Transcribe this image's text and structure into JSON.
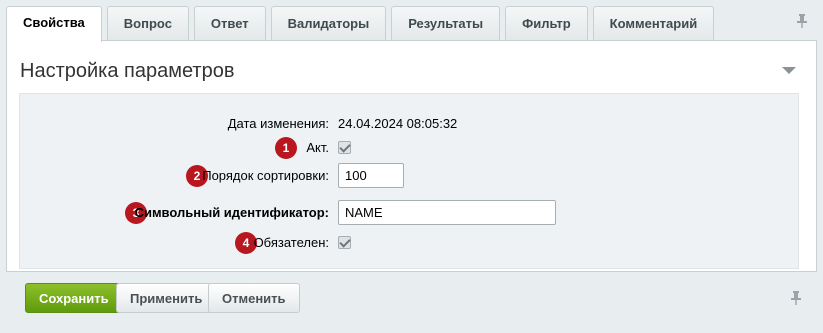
{
  "tabs": [
    "Свойства",
    "Вопрос",
    "Ответ",
    "Валидаторы",
    "Результаты",
    "Фильтр",
    "Комментарий"
  ],
  "section": {
    "title": "Настройка параметров"
  },
  "form": {
    "date_label": "Дата изменения:",
    "date_value": "24.04.2024 08:05:32",
    "active_label": "Акт.",
    "active_checked": true,
    "sort_label": "Порядок сортировки:",
    "sort_value": "100",
    "code_label": "Символьный идентификатор:",
    "code_value": "NAME",
    "required_label": "Обязателен:",
    "required_checked": true
  },
  "badges": [
    "1",
    "2",
    "3",
    "4"
  ],
  "buttons": {
    "save": "Сохранить",
    "apply": "Применить",
    "cancel": "Отменить"
  },
  "icons": {
    "pin": "pin-icon",
    "collapse": "chevron-down-icon"
  },
  "colors": {
    "primary_button": "#6fa91a",
    "badge": "#b8171f",
    "active_tab": "#ffffff"
  }
}
